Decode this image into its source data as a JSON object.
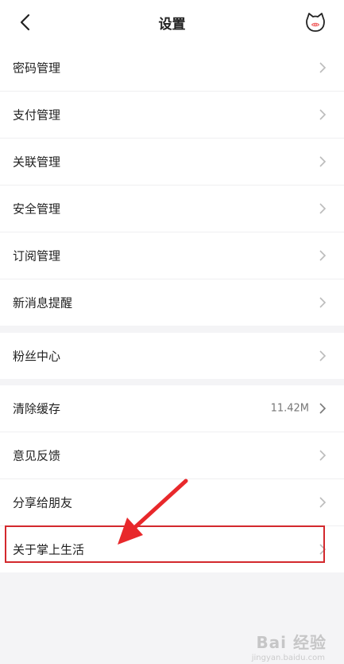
{
  "header": {
    "title": "设置",
    "back_icon": "chevron-left-icon",
    "mascot_icon": "cat-face-icon"
  },
  "group1": [
    {
      "label": "密码管理"
    },
    {
      "label": "支付管理"
    },
    {
      "label": "关联管理"
    },
    {
      "label": "安全管理"
    },
    {
      "label": "订阅管理"
    },
    {
      "label": "新消息提醒"
    }
  ],
  "group2": [
    {
      "label": "粉丝中心"
    }
  ],
  "group3": [
    {
      "label": "清除缓存",
      "value": "11.42M"
    },
    {
      "label": "意见反馈"
    },
    {
      "label": "分享给朋友"
    },
    {
      "label": "关于掌上生活"
    }
  ],
  "annotation": {
    "highlight_color": "#d3292d",
    "arrow_color": "#e8282b"
  },
  "watermark": {
    "text": "Bai 经验",
    "sub": "jingyan.baidu.com"
  }
}
